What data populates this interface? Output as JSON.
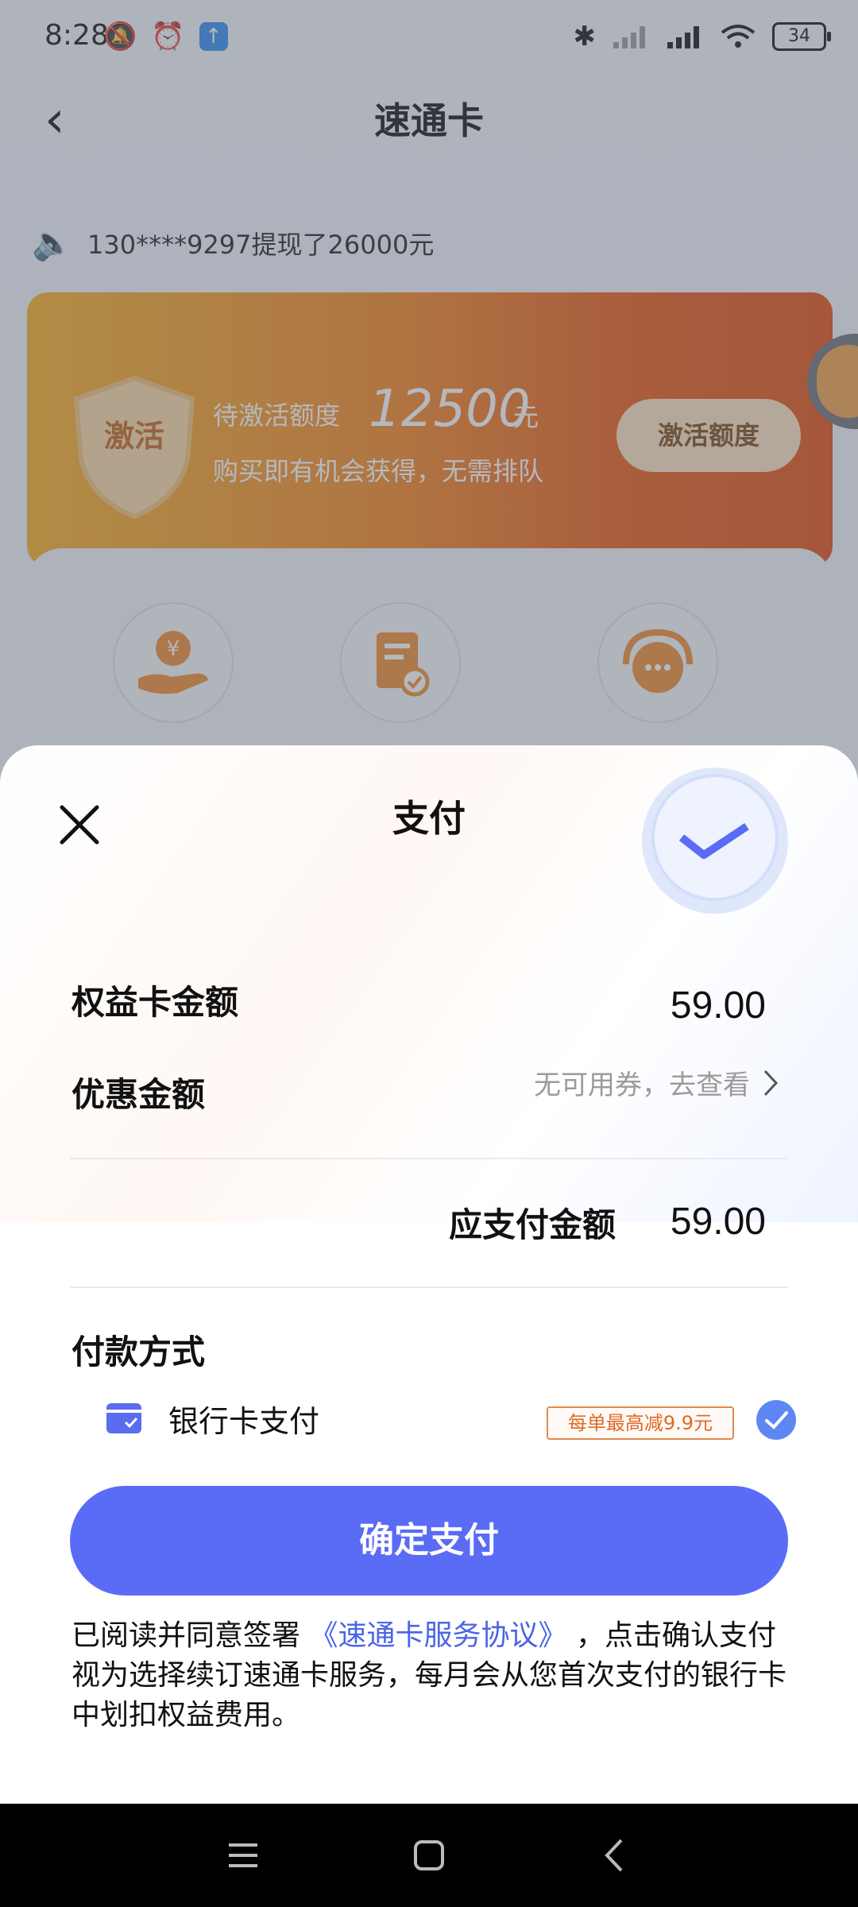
{
  "status_bar": {
    "time": "8:28",
    "battery": "34",
    "icons_left": [
      "mute-bell-icon",
      "alarm-icon",
      "upload-icon"
    ],
    "icons_right": [
      "bluetooth-icon",
      "signal-icon",
      "hd-signal-icon",
      "wifi-icon",
      "battery-icon"
    ]
  },
  "nav": {
    "back": "‹",
    "title": "速通卡"
  },
  "ticker": {
    "text": "130****9297提现了26000元"
  },
  "activate_banner": {
    "shield_text": "激活",
    "label": "待激活额度",
    "value": "12500",
    "unit": "元",
    "description": "购买即有机会获得，无需排队",
    "button": "激活额度"
  },
  "pay_sheet": {
    "title": "支付",
    "card_amount_label": "权益卡金额",
    "card_amount_value": "59.00",
    "discount_label": "优惠金额",
    "discount_hint": "无可用券，去查看",
    "payable_label": "应支付金额",
    "payable_value": "59.00",
    "pay_method_label": "付款方式",
    "bank_card_label": "银行卡支付",
    "promo_badge": "每单最高减9.9元",
    "confirm_button": "确定支付",
    "agreement_prefix": "已阅读并同意签署",
    "agreement_link": "《速通卡服务协议》",
    "agreement_suffix": "，点击确认支付视为选择续订速通卡服务，每月会从您首次支付的银行卡中划扣权益费用。"
  },
  "colors": {
    "primary": "#5a6cf5",
    "banner_orange": "#f5861f",
    "link": "#4a64e8"
  }
}
